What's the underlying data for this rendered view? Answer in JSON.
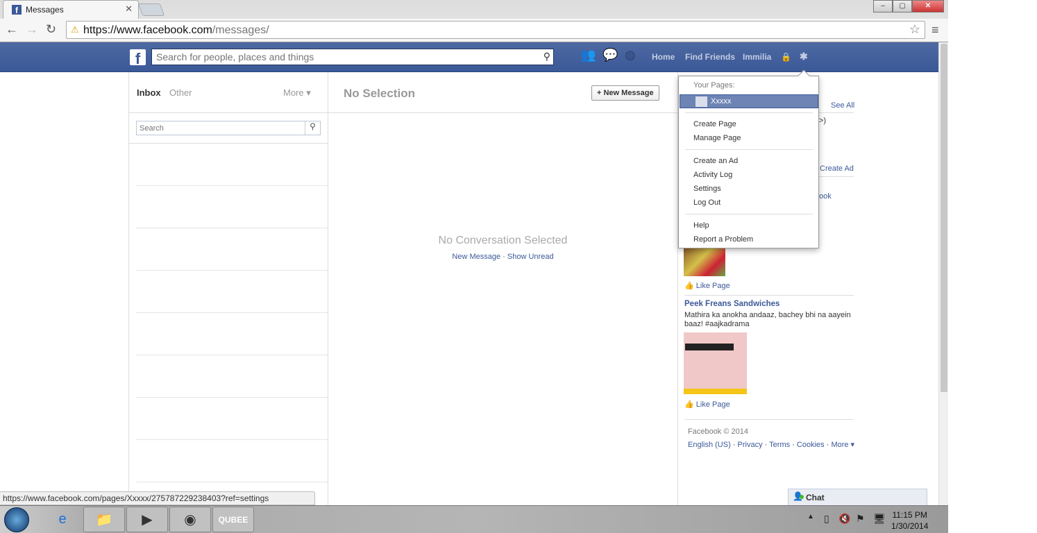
{
  "browser": {
    "tab_title": "Messages",
    "url_host": "https://www.facebook.com",
    "url_path": "/messages/",
    "window_buttons": [
      "–",
      "▢",
      "✕"
    ]
  },
  "fb": {
    "search_placeholder": "Search for people, places and things",
    "links": [
      "Home",
      "Find Friends",
      "Immilia"
    ]
  },
  "left": {
    "tabs": [
      "Inbox",
      "Other"
    ],
    "more": "More ▾",
    "search_placeholder": "Search"
  },
  "main": {
    "title": "No Selection",
    "new_message_button": "+ New Message",
    "empty_title": "No Conversation Selected",
    "link_new": "New Message",
    "link_unread": "Show Unread",
    "sep": " · "
  },
  "dropdown": {
    "your_pages": "Your Pages:",
    "page": "Xxxxx",
    "group1": [
      "Create Page",
      "Manage Page"
    ],
    "group2": [
      "Create an Ad",
      "Activity Log",
      "Settings",
      "Log Out"
    ],
    "group3": [
      "Help",
      "Report a Problem"
    ]
  },
  "right": {
    "see_all": "See All",
    "partial1": ">)",
    "create_ad": "Create Ad",
    "partial2": "ook",
    "like_page": "Like Page",
    "ad": {
      "title": "Peek Freans Sandwiches",
      "text": "Mathira ka anokha andaaz, bachey bhi na aayein baaz!  #aajkadrama"
    },
    "footer": {
      "copyright": "Facebook © 2014",
      "links": [
        "English (US)",
        "Privacy",
        "Terms",
        "Cookies",
        "More ▾"
      ]
    }
  },
  "chat": {
    "label": "Chat"
  },
  "status_url": "https://www.facebook.com/pages/Xxxxx/275787229238403?ref=settings",
  "taskbar": {
    "time": "11:15 PM",
    "date": "1/30/2014"
  },
  "colors": {
    "fb_blue": "#3b5998",
    "dropdown_selected": "#6d84b4"
  }
}
